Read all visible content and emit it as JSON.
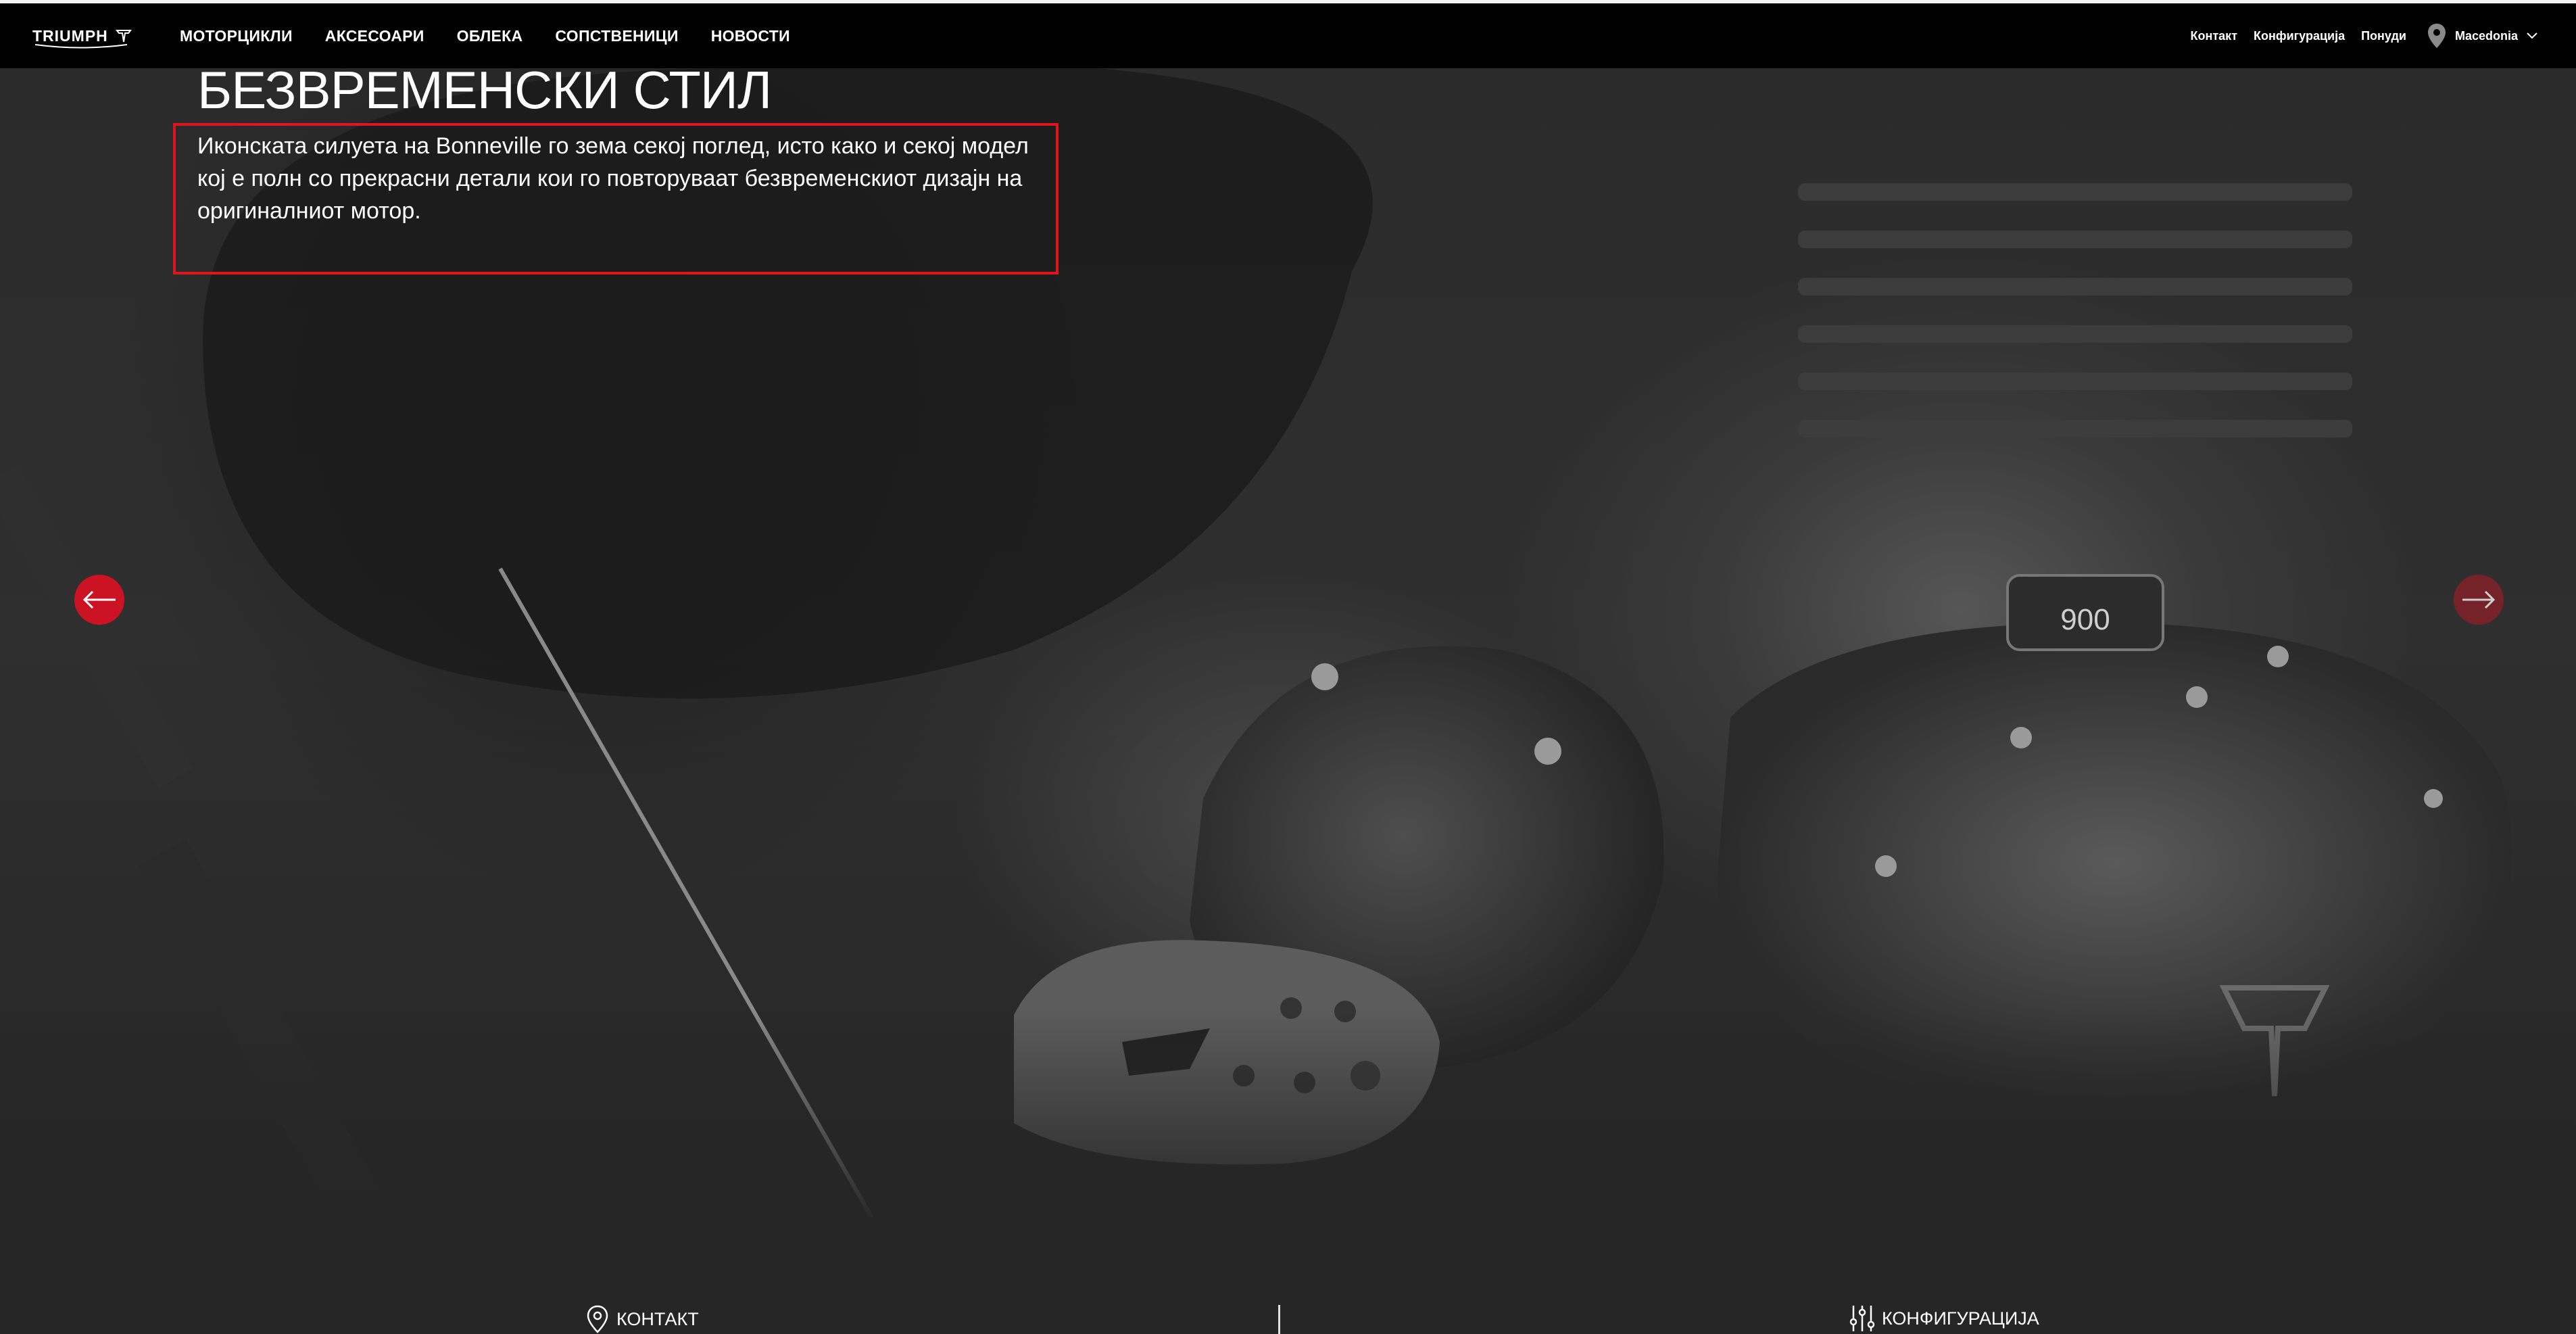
{
  "header": {
    "logo_text": "TRIUMPH",
    "main_nav": [
      {
        "label": "МОТОРЦИКЛИ"
      },
      {
        "label": "АКСЕСОАРИ"
      },
      {
        "label": "ОБЛЕКА"
      },
      {
        "label": "СОПСТВЕНИЦИ"
      },
      {
        "label": "НОВОСТИ"
      }
    ],
    "util_nav": [
      {
        "label": "Контакт"
      },
      {
        "label": "Конфигурација"
      },
      {
        "label": "Понуди"
      }
    ],
    "region": {
      "label": "Macedonia",
      "icon": "location-pin-icon"
    }
  },
  "hero": {
    "title": "БЕЗВРЕМЕНСКИ СТИЛ",
    "text": "Иконската силуета на Bonneville го зема секој поглед, исто како и секој модел кој е полн со прекрасни детали кои го повторуваат безвременскиот дизајн на оригиналниот мотор.",
    "engine_badge": "900",
    "highlight_color": "#e0151c",
    "prev_icon": "arrow-left-icon",
    "next_icon": "arrow-right-icon",
    "accent_color": "#cc1323"
  },
  "footer": {
    "contact_label": "КОНТАКТ",
    "contact_icon": "location-pin-icon",
    "config_label": "КОНФИГУРАЦИЈА",
    "config_icon": "sliders-icon"
  }
}
